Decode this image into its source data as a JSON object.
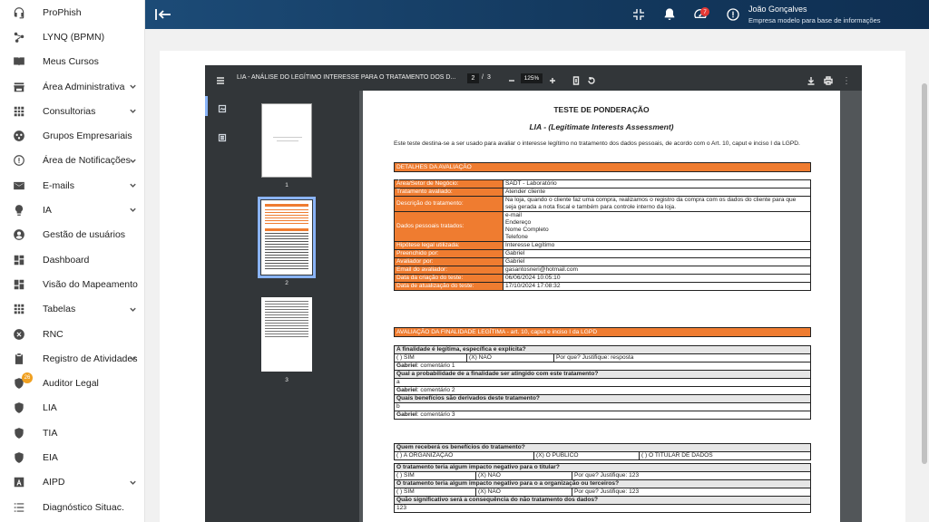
{
  "sidebar": {
    "items": [
      {
        "label": "ProPhish",
        "icon": "headset-icon",
        "expandable": false
      },
      {
        "label": "LYNQ (BPMN)",
        "icon": "flow-icon",
        "expandable": false
      },
      {
        "label": "Meus Cursos",
        "icon": "book-icon",
        "expandable": false
      },
      {
        "label": "Área Administrativa",
        "icon": "store-icon",
        "expandable": true
      },
      {
        "label": "Consultorias",
        "icon": "grid-icon",
        "expandable": true
      },
      {
        "label": "Grupos Empresariais",
        "icon": "group-icon",
        "expandable": false
      },
      {
        "label": "Área de Notificações",
        "icon": "alert-circle-icon",
        "expandable": true
      },
      {
        "label": "E-mails",
        "icon": "mail-icon",
        "expandable": true
      },
      {
        "label": "IA",
        "icon": "bulb-icon",
        "expandable": true
      },
      {
        "label": "Gestão de usuários",
        "icon": "user-icon",
        "expandable": false
      },
      {
        "label": "Dashboard",
        "icon": "dashboard-icon",
        "expandable": false
      },
      {
        "label": "Visão do Mapeamento",
        "icon": "dashboard-icon",
        "expandable": false
      },
      {
        "label": "Tabelas",
        "icon": "grid-icon",
        "expandable": true
      },
      {
        "label": "RNC",
        "icon": "cancel-icon",
        "expandable": false
      },
      {
        "label": "Registro de Atividades",
        "icon": "clipboard-icon",
        "expandable": true
      },
      {
        "label": "Auditor Legal",
        "icon": "shield-icon",
        "expandable": false,
        "badge": "26"
      },
      {
        "label": "LIA",
        "icon": "shield-icon",
        "expandable": false
      },
      {
        "label": "TIA",
        "icon": "shield-icon",
        "expandable": false
      },
      {
        "label": "EIA",
        "icon": "shield-icon",
        "expandable": false
      },
      {
        "label": "AIPD",
        "icon": "letter-a-icon",
        "expandable": true
      },
      {
        "label": "Diagnóstico Situac.",
        "icon": "list-icon",
        "expandable": false
      }
    ]
  },
  "header": {
    "notification_count": "7",
    "user_name": "João Gonçalves",
    "company": "Empresa modelo para base de informações"
  },
  "pdf": {
    "title": "LIA - ANÁLISE DO LEGÍTIMO INTERESSE PARA O TRATAMENTO DOS D...",
    "current_page": "2",
    "page_sep": "/",
    "total_pages": "3",
    "zoom": "125%",
    "thumbs": [
      "1",
      "2",
      "3"
    ]
  },
  "doc": {
    "title": "TESTE DE PONDERAÇÃO",
    "subtitle": "LIA - (Legitimate Interests Assessment)",
    "intro": "Este teste destina-se a ser usado para avaliar o interesse legítimo no tratamento dos dados pessoais, de acordo com o Art. 10, caput e inciso I da LGPD.",
    "section1": "DETALHES DA AVALIAÇÃO",
    "details": [
      {
        "k": "Área/Setor de Negócio:",
        "v": "SADT - Laboratório"
      },
      {
        "k": "Tratamento avaliado:",
        "v": "Atender cliente"
      },
      {
        "k": "Descrição do tratamento:",
        "v": "Na loja, quando o cliente faz uma compra, realizamos o registro da compra com os dados do cliente para que seja gerada a nota fiscal e também para controle interno da loja."
      },
      {
        "k": "Dados pessoais tratados:",
        "v1": "e-mail",
        "v2": "Endereço",
        "v3": "Nome Completo",
        "v4": "Telefone"
      },
      {
        "k": "Hipótese legal utilizada:",
        "v": "Interesse Legítimo"
      },
      {
        "k": "Preenchido por:",
        "v": "Gabriel"
      },
      {
        "k": "Avaliador por:",
        "v": "Gabriel"
      },
      {
        "k": "Email do avaliador:",
        "v": "gasantosneri@hotmail.com"
      },
      {
        "k": "Data da criação do teste:",
        "v": "06/06/2024 10:05:10"
      },
      {
        "k": "Data de atualização do teste:",
        "v": "17/10/2024 17:08:32"
      }
    ],
    "section2": "AVALIAÇÃO DA FINALIDADE LEGÍTIMA - art. 10, caput e inciso I da LGPD",
    "q1": "A finalidade é legítima, específica e explícita?",
    "q1_sim": "( ) SIM",
    "q1_nao": "(X) NÃO",
    "q1_just": "Por que? Justifique: resposta",
    "q1_comment_author": "Gabriel",
    "q1_comment": ": comentário 1",
    "q2": "Qual a probabilidade de a finalidade ser atingido com este tratamento?",
    "q2_answer": "a",
    "q2_comment_author": "Gabriel",
    "q2_comment": ": comentário 2",
    "q3": "Quais benefícios são derivados deste tratamento?",
    "q3_answer": "b",
    "q3_comment_author": "Gabriel",
    "q3_comment": ": comentário 3",
    "q4": "Quem receberá os benefícios do tratamento?",
    "q4_a": "( ) A ORGANIZAÇÃO",
    "q4_b": "(X) O PÚBLICO",
    "q4_c": "( ) O TITULAR DE DADOS",
    "q5": "O tratamento teria algum impacto negativo para o titular?",
    "q5_sim": "( ) SIM",
    "q5_nao": "(X) NÃO",
    "q5_just": "Por que? Justifique: 123",
    "q6": "O tratamento teria algum impacto negativo para o a organização ou terceiros?",
    "q6_sim": "( ) SIM",
    "q6_nao": "(X) NÃO",
    "q6_just": "Por que? Justifique: 123",
    "q7": "Quão significativo será a consequência do não tratamento dos dados?",
    "q7_answer": "123"
  }
}
